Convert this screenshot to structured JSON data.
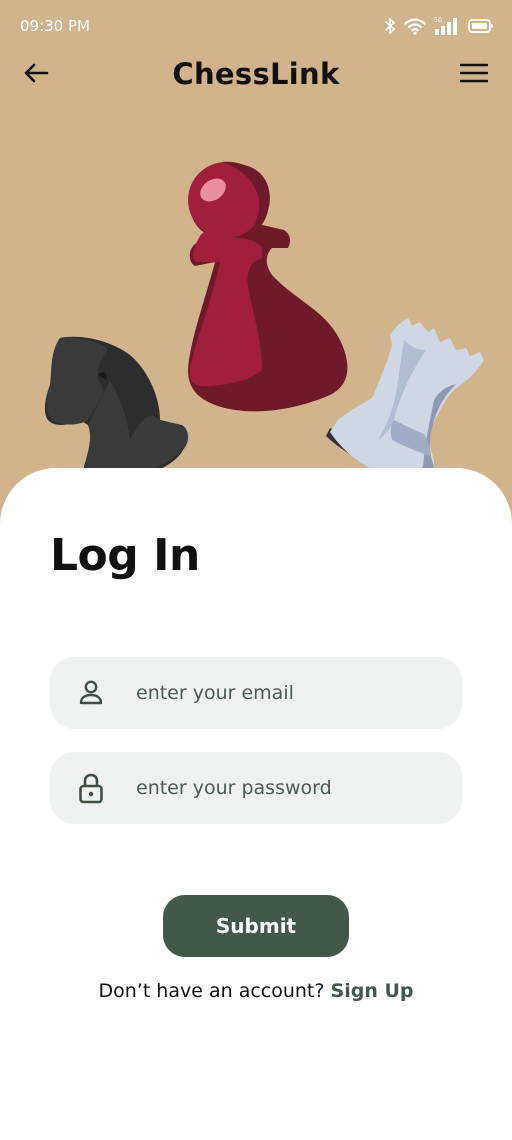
{
  "status_bar": {
    "time": "09:30 PM",
    "icons": [
      "bluetooth-icon",
      "wifi-icon",
      "signal-icon",
      "battery-icon"
    ],
    "network_label": "5G"
  },
  "app_bar": {
    "title": "ChessLink",
    "back_icon": "arrow-left-icon",
    "menu_icon": "hamburger-menu-icon"
  },
  "hero": {
    "background_color": "#d2b48c",
    "pieces": [
      "knight",
      "pawn",
      "rook"
    ]
  },
  "login": {
    "title": "Log In",
    "email": {
      "icon": "user-icon",
      "placeholder": "enter your email",
      "value": ""
    },
    "password": {
      "icon": "lock-icon",
      "placeholder": "enter your password",
      "value": ""
    },
    "submit_label": "Submit",
    "signup_prompt": "Don’t have an account?",
    "signup_link": "Sign Up"
  },
  "colors": {
    "accent": "#43574a",
    "field_bg": "#f0f2f1",
    "title_text": "#111111"
  }
}
